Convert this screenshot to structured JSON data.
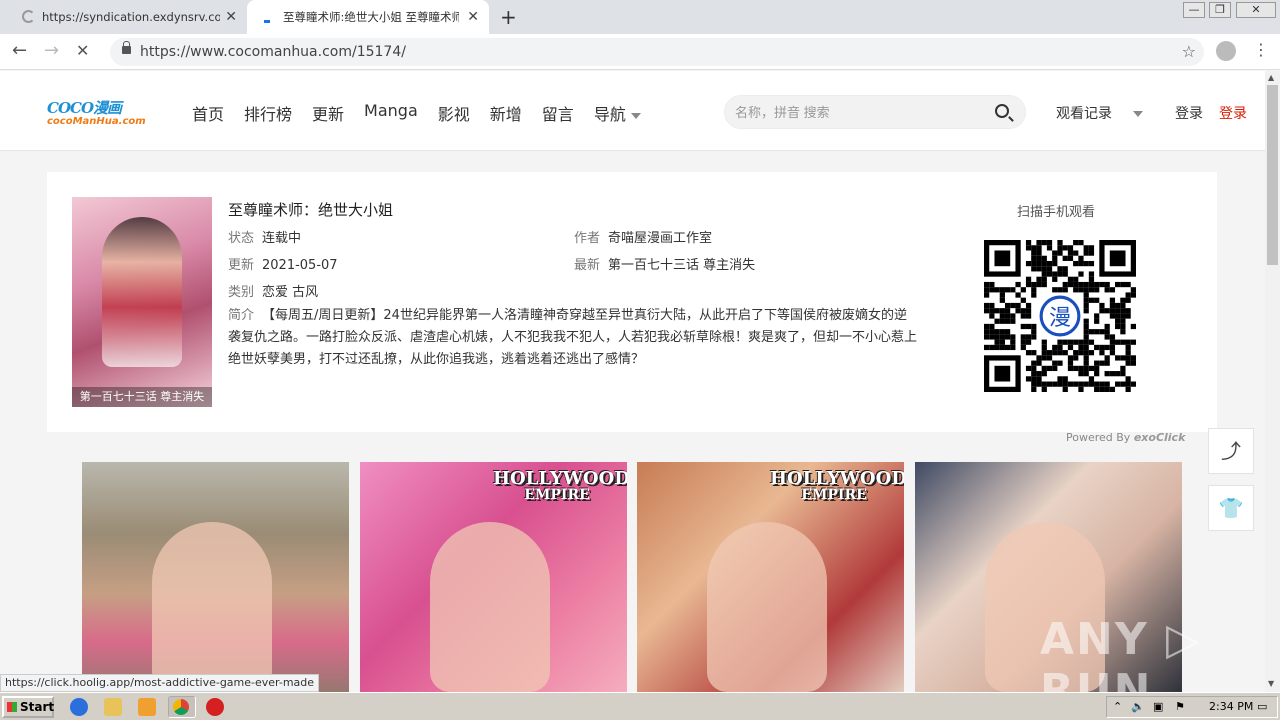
{
  "browser": {
    "tabs": [
      {
        "title": "https://syndication.exdynsrv.com/sp",
        "loading": true
      },
      {
        "title": "至尊瞳术师:绝世大小姐 至尊瞳术师",
        "active": true
      }
    ],
    "close_glyph": "✕",
    "new_tab_glyph": "+",
    "url": "https://www.cocomanhua.com/15174/",
    "window_controls": [
      "—",
      "❐",
      "✕"
    ],
    "status_url": "https://click.hoolig.app/most-addictive-game-ever-made"
  },
  "site": {
    "logo_main": "COCO",
    "logo_cn": "漫画",
    "logo_sub": "cocoManHua.com",
    "nav": [
      "首页",
      "排行榜",
      "更新",
      "Manga",
      "影视",
      "新增",
      "留言",
      "导航"
    ],
    "search_placeholder": "名称，拼音 搜索",
    "history": "观看记录",
    "login": "登录",
    "register": "登录"
  },
  "comic": {
    "title": "至尊瞳术师：绝世大小姐",
    "cover_caption": "第一百七十三话 尊主消失",
    "status_label": "状态",
    "status": "连载中",
    "author_label": "作者",
    "author": "奇喵屋漫画工作室",
    "updated_label": "更新",
    "updated": "2021-05-07",
    "latest_label": "最新",
    "latest": "第一百七十三话 尊主消失",
    "category_label": "类别",
    "category": "恋爱 古风",
    "intro_label": "简介",
    "intro": "【每周五/周日更新】24世纪异能界第一人洛清瞳神奇穿越至异世真衍大陆，从此开启了下等国侯府被废嫡女的逆袭复仇之路。一路打脸众反派、虐渣虐心机婊，人不犯我我不犯人，人若犯我必斩草除根！爽是爽了，但却一不小心惹上绝世妖孽美男，打不过还乱撩，从此你追我逃，逃着逃着还逃出了感情？",
    "qr_label": "扫描手机观看",
    "qr_center": "漫"
  },
  "ads": {
    "powered_by": "Powered By",
    "powered_brand": "exoClick",
    "items": [
      {
        "brand1": "",
        "brand2": ""
      },
      {
        "brand1": "HOLLYWOOD",
        "brand2": "EMPIRE"
      },
      {
        "brand1": "HOLLYWOOD",
        "brand2": "EMPIRE"
      },
      {
        "brand1": "",
        "brand2": ""
      }
    ]
  },
  "side_buttons": {
    "share_icon": "⤴",
    "shirt_icon": "👕"
  },
  "watermark": "ANY ▷ RUN",
  "taskbar": {
    "start": "Start",
    "time": "2:34 PM"
  }
}
